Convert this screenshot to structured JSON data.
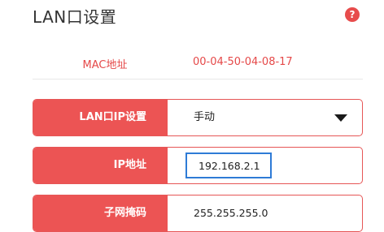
{
  "page": {
    "title": "LAN口设置",
    "help_icon_glyph": "?"
  },
  "mac": {
    "label": "MAC地址",
    "value": "00-04-50-04-08-17"
  },
  "lan_mode": {
    "label": "LAN口IP设置",
    "selected": "手动",
    "icon": "chevron-down-icon"
  },
  "ip": {
    "label": "IP地址",
    "value": "192.168.2.1"
  },
  "subnet": {
    "label": "子网掩码",
    "value": "255.255.255.0"
  },
  "colors": {
    "accent": "#ec5454",
    "accent_text": "#e54848",
    "focus_border": "#2e7bd6"
  }
}
